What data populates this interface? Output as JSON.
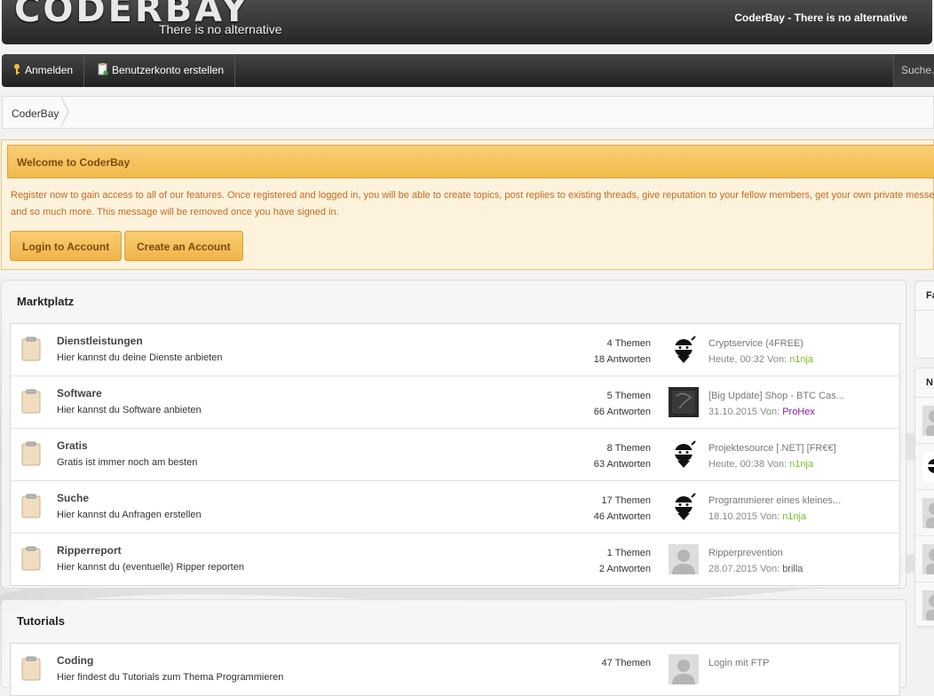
{
  "header": {
    "logo_text": "CODERBAY",
    "tagline": "There is no alternative",
    "title": "CoderBay - There is no alternative"
  },
  "nav": {
    "login": {
      "label": "Anmelden",
      "icon": "key-icon"
    },
    "register": {
      "label": "Benutzerkonto erstellen",
      "icon": "clipboard-add-icon"
    },
    "search_placeholder": "Suche..."
  },
  "breadcrumb": {
    "home": "CoderBay"
  },
  "welcome": {
    "title": "Welcome to CoderBay",
    "line1": "Register now to gain access to all of our features. Once registered and logged in, you will be able to create topics, post replies to existing threads, give reputation to your fellow members, get your own private messe",
    "line2": "and so much more. This message will be removed once you have signed in.",
    "login_button": "Login to Account",
    "create_button": "Create an Account"
  },
  "sections": [
    {
      "title": "Marktplatz",
      "forums": [
        {
          "name": "Dienstleistungen",
          "description": "Hier kannst du deine Dienste anbieten",
          "topics": "4 Themen",
          "replies": "18 Antworten",
          "last_title": "Cryptservice (4FREE)",
          "last_date": "Heute, 00:32 Von: ",
          "last_user": "n1nja",
          "user_color": "#7dbb2a",
          "avatar": "ninja"
        },
        {
          "name": "Software",
          "description": "Hier kannst du Software anbieten",
          "topics": "5 Themen",
          "replies": "66 Antworten",
          "last_title": "[Big Update] Shop - BTC Cas...",
          "last_date": "31.10.2015 Von: ",
          "last_user": "ProHex",
          "user_color": "#8a1ca0",
          "avatar": "dark"
        },
        {
          "name": "Gratis",
          "description": "Gratis ist immer noch am besten",
          "topics": "8 Themen",
          "replies": "63 Antworten",
          "last_title": "Projektesource [.NET] [FR€€]",
          "last_date": "Heute, 00:38 Von: ",
          "last_user": "n1nja",
          "user_color": "#7dbb2a",
          "avatar": "ninja"
        },
        {
          "name": "Suche",
          "description": "Hier kannst du Anfragen erstellen",
          "topics": "17 Themen",
          "replies": "46 Antworten",
          "last_title": "Programmierer eines kleines...",
          "last_date": "18.10.2015 Von: ",
          "last_user": "n1nja",
          "user_color": "#7dbb2a",
          "avatar": "ninja"
        },
        {
          "name": "Ripperreport",
          "description": "Hier kannst du (eventuelle) Ripper reporten",
          "topics": "1 Themen",
          "replies": "2 Antworten",
          "last_title": "Ripperprevention",
          "last_date": "28.07.2015 Von: ",
          "last_user": "brilla",
          "user_color": "#555555",
          "avatar": "default"
        }
      ]
    },
    {
      "title": "Tutorials",
      "forums": [
        {
          "name": "Coding",
          "description": "Hier findest du Tutorials zum Thema Programmieren",
          "topics": "47 Themen",
          "replies": "",
          "last_title": "Login mit FTP",
          "last_date": "",
          "last_user": "",
          "user_color": "#555555",
          "avatar": "default"
        }
      ]
    }
  ],
  "right_panels": [
    {
      "head": "Fa"
    },
    {
      "head": "N"
    }
  ]
}
